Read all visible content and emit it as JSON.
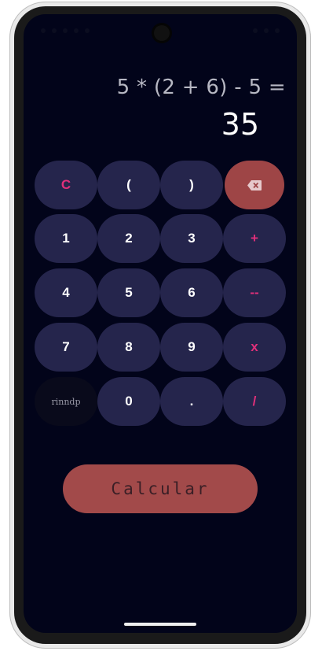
{
  "display": {
    "expression": "5 * (2 + 6) - 5 =",
    "result": "35"
  },
  "keys": {
    "clear": "C",
    "open_paren": "(",
    "close_paren": ")",
    "backspace_icon": "backspace-icon",
    "one": "1",
    "two": "2",
    "three": "3",
    "plus": "+",
    "four": "4",
    "five": "5",
    "six": "6",
    "minus": "--",
    "seven": "7",
    "eight": "8",
    "nine": "9",
    "multiply": "x",
    "rinndp": "rinndp",
    "zero": "0",
    "dot": ".",
    "divide": "/"
  },
  "action": {
    "calculate_label": "Calcular"
  },
  "colors": {
    "background": "#02041a",
    "key": "#25254c",
    "operator_text": "#e0307a",
    "delete_key": "#9e4546",
    "calculate_button": "#a24a4a"
  }
}
